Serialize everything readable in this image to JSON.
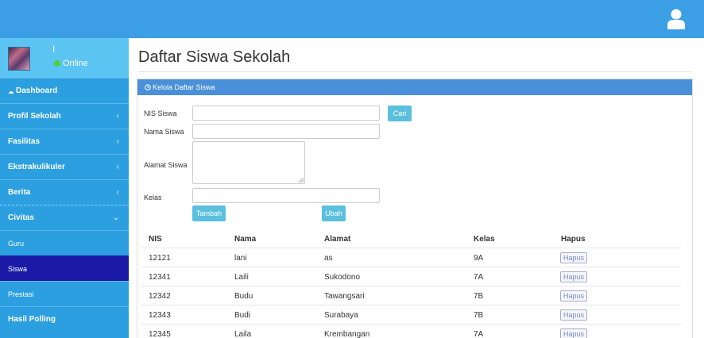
{
  "header": {
    "user_icon": "user-icon"
  },
  "sidebar": {
    "profile": {
      "name": "I",
      "status": "Online"
    },
    "items": [
      {
        "label": "Dashboard",
        "icon": "dashboard-icon"
      },
      {
        "label": "Profil Sekolah",
        "chevron": "‹"
      },
      {
        "label": "Fasilitas",
        "chevron": "‹"
      },
      {
        "label": "Ekstrakulikuler",
        "chevron": "‹"
      },
      {
        "label": "Berita",
        "chevron": "‹"
      },
      {
        "label": "Civitas",
        "chevron": "⌄"
      }
    ],
    "sub_items": [
      {
        "label": "Guru"
      },
      {
        "label": "Siswa"
      },
      {
        "label": "Prestasi"
      }
    ],
    "bottom_item": {
      "label": "Hasil Polling"
    }
  },
  "main": {
    "title": "Daftar Siswa Sekolah",
    "panel_title": "Kelola Daftar Siswa",
    "form": {
      "nis_label": "NIS Siswa",
      "nama_label": "Nama Siswa",
      "alamat_label": "Alamat Siswa",
      "kelas_label": "Kelas",
      "cari_button": "Cari",
      "tambah_button": "Tambah",
      "ubah_button": "Ubah"
    },
    "table": {
      "headers": [
        "NIS",
        "Nama",
        "Alamat",
        "Kelas",
        "Hapus"
      ],
      "rows": [
        {
          "nis": "12121",
          "nama": "lani",
          "alamat": "as",
          "kelas": "9A",
          "hapus": "Hapus"
        },
        {
          "nis": "12341",
          "nama": "Laili",
          "alamat": "Sukodono",
          "kelas": "7A",
          "hapus": "Hapus"
        },
        {
          "nis": "12342",
          "nama": "Budu",
          "alamat": "Tawangsari",
          "kelas": "7B",
          "hapus": "Hapus"
        },
        {
          "nis": "12343",
          "nama": "Budi",
          "alamat": "Surabaya",
          "kelas": "7B",
          "hapus": "Hapus"
        },
        {
          "nis": "12345",
          "nama": "Laila",
          "alamat": "Krembangan",
          "kelas": "7A",
          "hapus": "Hapus"
        }
      ]
    }
  },
  "colors": {
    "topbar": "#3c9ee5",
    "sidebar": "#2b9fe0",
    "active": "#1a1aa6",
    "button": "#5bc0de",
    "panel_head": "#4a90d8"
  }
}
